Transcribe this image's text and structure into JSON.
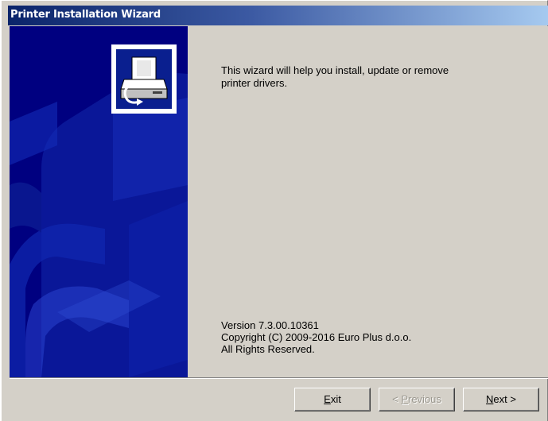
{
  "window": {
    "title": "Printer Installation Wizard"
  },
  "banner": {
    "icon": "printer-install-icon"
  },
  "content": {
    "intro_line1": "This wizard will help you install, update or remove",
    "intro_line2": "printer drivers.",
    "version": "Version 7.3.00.10361",
    "copyright": "Copyright (C) 2009-2016 Euro Plus d.o.o.",
    "rights": "All Rights Reserved."
  },
  "buttons": {
    "exit": {
      "mnemonic": "E",
      "rest": "xit",
      "enabled": true
    },
    "previous": {
      "prefix": "< ",
      "mnemonic": "P",
      "rest": "revious",
      "enabled": false
    },
    "next": {
      "mnemonic": "N",
      "rest": "ext >",
      "enabled": true
    }
  },
  "colors": {
    "banner_blue": "#000080",
    "title_gradient_start": "#0a246a",
    "face": "#d4d0c8"
  }
}
